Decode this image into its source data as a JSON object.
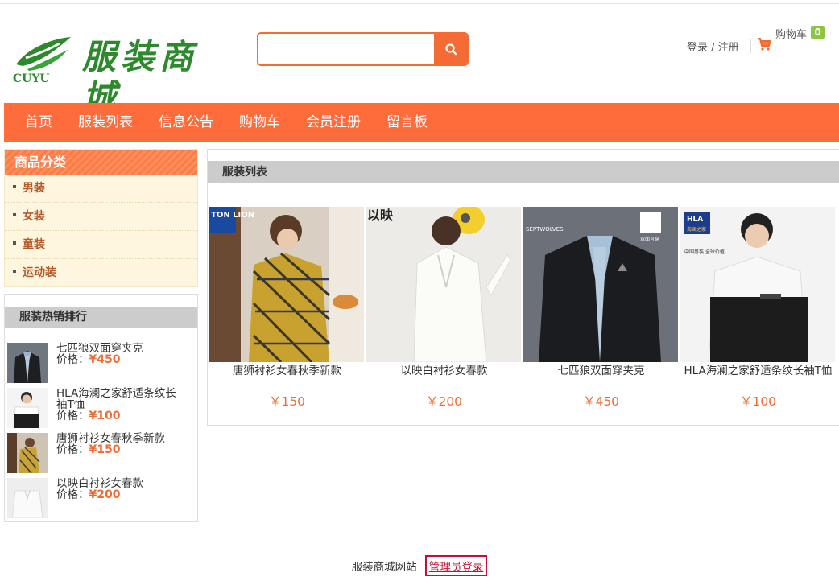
{
  "brand": {
    "logo_text": "CUYU",
    "title": "服装商城"
  },
  "search": {
    "placeholder": "",
    "value": ""
  },
  "header": {
    "login_label": "登录 / 注册",
    "cart_label": "购物车",
    "cart_count": "0"
  },
  "nav": {
    "items": [
      "首页",
      "服装列表",
      "信息公告",
      "购物车",
      "会员注册",
      "留言板"
    ]
  },
  "categories": {
    "title": "商品分类",
    "items": [
      "男装",
      "女装",
      "童装",
      "运动装"
    ]
  },
  "hot": {
    "title": "服装热销排行",
    "price_label": "价格：",
    "items": [
      {
        "name": "七匹狼双面穿夹克",
        "price": "¥450"
      },
      {
        "name": "HLA海澜之家舒适条纹长袖T恤",
        "price": "¥100"
      },
      {
        "name": "唐狮衬衫女春秋季新款",
        "price": "¥150"
      },
      {
        "name": "以映白衬衫女春款",
        "price": "¥200"
      }
    ]
  },
  "main": {
    "title": "服装列表",
    "products": [
      {
        "name": "唐狮衬衫女春秋季新款",
        "price": "￥150",
        "badge": "TON LION"
      },
      {
        "name": "以映白衬衫女春款",
        "price": "￥200",
        "badge": "以映"
      },
      {
        "name": "七匹狼双面穿夹克",
        "price": "￥450",
        "badge": "SEPTWOLVES",
        "tag": "双面可穿"
      },
      {
        "name": "HLA海澜之家舒适条纹长袖T恤",
        "price": "￥100",
        "badge": "HLA",
        "badge_sub": "海澜之家",
        "tag": "中国男装 全球价值"
      }
    ]
  },
  "footer": {
    "site_text": "服装商城网站",
    "admin_label": "管理员登录"
  },
  "colors": {
    "accent": "#ff6c3b",
    "price": "#f26a2f",
    "brand_green": "#2c8a2c",
    "admin_red": "#c8102e"
  }
}
